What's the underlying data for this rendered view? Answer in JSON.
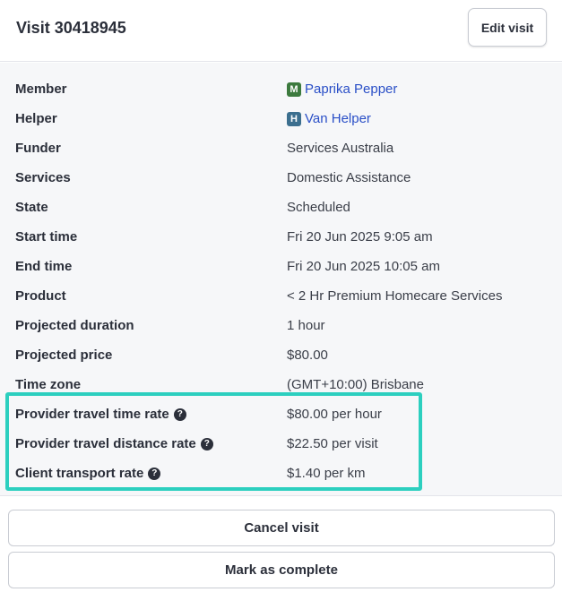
{
  "header": {
    "title": "Visit 30418945",
    "edit_label": "Edit visit"
  },
  "details": {
    "member": {
      "label": "Member",
      "badge": "M",
      "value": "Paprika Pepper"
    },
    "helper": {
      "label": "Helper",
      "badge": "H",
      "value": "Van Helper"
    },
    "funder": {
      "label": "Funder",
      "value": "Services Australia"
    },
    "services": {
      "label": "Services",
      "value": "Domestic Assistance"
    },
    "state": {
      "label": "State",
      "value": "Scheduled"
    },
    "start_time": {
      "label": "Start time",
      "value": "Fri 20 Jun 2025 9:05 am"
    },
    "end_time": {
      "label": "End time",
      "value": "Fri 20 Jun 2025 10:05 am"
    },
    "product": {
      "label": "Product",
      "value": "< 2 Hr Premium Homecare Services"
    },
    "projected_duration": {
      "label": "Projected duration",
      "value": "1 hour"
    },
    "projected_price": {
      "label": "Projected price",
      "value": "$80.00"
    },
    "time_zone": {
      "label": "Time zone",
      "value": "(GMT+10:00) Brisbane"
    },
    "provider_travel_time_rate": {
      "label": "Provider travel time rate",
      "value": "$80.00 per hour"
    },
    "provider_travel_distance_rate": {
      "label": "Provider travel distance rate",
      "value": "$22.50 per visit"
    },
    "client_transport_rate": {
      "label": "Client transport rate",
      "value": "$1.40 per km"
    },
    "help_glyph": "?"
  },
  "actions": {
    "cancel_label": "Cancel visit",
    "complete_label": "Mark as complete"
  },
  "colors": {
    "highlight": "#2ccfbf",
    "member_badge": "#3c7a3e",
    "helper_badge": "#3c6f8f",
    "link": "#2a4fc7"
  },
  "icons": {
    "help": "question-circle-icon"
  }
}
